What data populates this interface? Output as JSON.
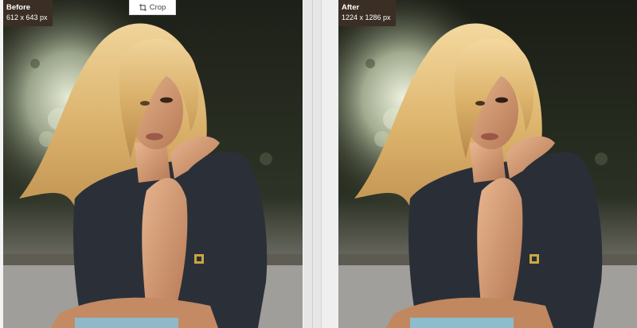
{
  "toolbar": {
    "crop_label": "Crop",
    "crop_icon": "crop-icon"
  },
  "before": {
    "title": "Before",
    "size": "612 x 643 px"
  },
  "after": {
    "title": "After",
    "size": "1224 x 1286 px"
  },
  "colors": {
    "badge_bg": "#3b2f25",
    "background": "#ececec",
    "shirt": "#2b3038",
    "skin": "#d9a07a",
    "hair": "#e6c27f"
  }
}
